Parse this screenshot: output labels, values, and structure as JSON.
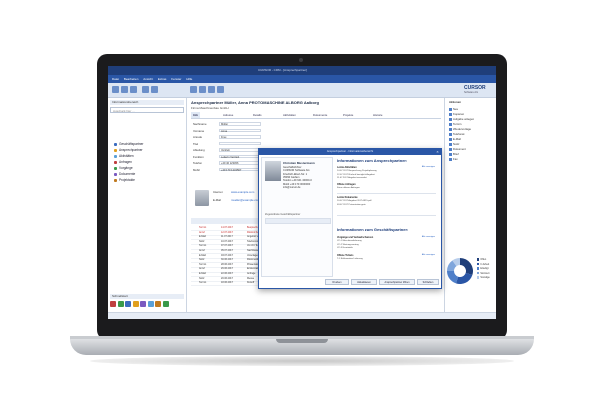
{
  "app": {
    "window_title": "CURSOR - CRM - [Ansprechpartner]",
    "menu": [
      "Datei",
      "Bearbeiten",
      "Ansicht",
      "Extras",
      "Fenster",
      "Hilfe"
    ],
    "brand": "CURSOR",
    "brand_sub": "Software AG"
  },
  "left": {
    "header": "Informationsbereich",
    "search_placeholder": "Ausdruck hier ...",
    "nav": [
      {
        "label": "Geschäftspartner",
        "color": "#3b6cc0"
      },
      {
        "label": "Ansprechpartner",
        "color": "#e0a020"
      },
      {
        "label": "Aktivitäten",
        "color": "#5aa0d8"
      },
      {
        "label": "Anfragen",
        "color": "#c04040"
      },
      {
        "label": "Vorgänge",
        "color": "#3a9a4a"
      },
      {
        "label": "Dokumente",
        "color": "#7a5ac0"
      },
      {
        "label": "Projektakte",
        "color": "#c07a20"
      }
    ],
    "bottom_header": "Schnellstart",
    "bottom_colors": [
      "#c04040",
      "#3a9a4a",
      "#3b6cc0",
      "#e0a020",
      "#7a5ac0",
      "#5aa0d8",
      "#c07a20",
      "#3a9a4a"
    ]
  },
  "main": {
    "title": "Ansprechpartner  Müller, Anna  PROTOMASCHINE ALBORG  Aalborg",
    "subtitle": "Firma  Maschinenbau GmbH",
    "tabs": [
      "Info",
      "Adresse",
      "Details",
      "Aktivitäten",
      "Dokumente",
      "Projekte",
      "Historie"
    ],
    "fields": [
      {
        "label": "Nachname",
        "value": "Müller"
      },
      {
        "label": "Vorname",
        "value": "Anna"
      },
      {
        "label": "Anrede",
        "value": "Frau"
      },
      {
        "label": "Titel",
        "value": ""
      },
      {
        "label": "Abteilung",
        "value": "Vertrieb"
      },
      {
        "label": "Funktion",
        "value": "Leiterin Vertrieb"
      },
      {
        "label": "Telefon",
        "value": "+49 40 123456"
      },
      {
        "label": "Mobil",
        "value": "+49 170 1234567"
      }
    ],
    "contact": {
      "email_label": "E-Mail",
      "email": "mueller@example.com",
      "web_label": "Internet",
      "web": "www.example.com"
    },
    "grid_rows": [
      {
        "c1": "Termin",
        "c2": "14.07.2017",
        "c3": "Besprechung Projekt",
        "red": true
      },
      {
        "c1": "Anruf",
        "c2": "12.07.2017",
        "c3": "Rückruf Angebot",
        "red": true
      },
      {
        "c1": "E-Mail",
        "c2": "11.07.2017",
        "c3": "Angebot versendet",
        "red": false
      },
      {
        "c1": "Notiz",
        "c2": "10.07.2017",
        "c3": "Telefonnotiz",
        "red": false
      },
      {
        "c1": "Termin",
        "c2": "07.07.2017",
        "c3": "Vor-Ort Termin",
        "red": false
      },
      {
        "c1": "Anruf",
        "c2": "05.07.2017",
        "c3": "Nachfassen",
        "red": false
      },
      {
        "c1": "E-Mail",
        "c2": "03.07.2017",
        "c3": "Unterlagen",
        "red": false
      },
      {
        "c1": "Notiz",
        "c2": "30.06.2017",
        "c3": "Rückmeldung",
        "red": false
      },
      {
        "c1": "Termin",
        "c2": "28.06.2017",
        "c3": "Präsentation",
        "red": false
      },
      {
        "c1": "Anruf",
        "c2": "26.06.2017",
        "c3": "Erstkontakt",
        "red": false
      },
      {
        "c1": "E-Mail",
        "c2": "22.06.2017",
        "c3": "Anfrage",
        "red": false
      },
      {
        "c1": "Notiz",
        "c2": "20.06.2017",
        "c3": "Messe",
        "red": false
      },
      {
        "c1": "Termin",
        "c2": "18.06.2017",
        "c3": "Kickoff",
        "red": false
      }
    ]
  },
  "right": {
    "header": "Aktionen",
    "items": [
      "Neu",
      "Kopieren",
      "Aufgabe anlegen",
      "Termin",
      "Wiedervorlage",
      "Telefonat",
      "E-Mail",
      "Notiz",
      "Dokument",
      "Brief",
      "Fax"
    ],
    "chart_legend": [
      {
        "label": "Offen",
        "color": "#1f3e7a"
      },
      {
        "label": "In Arbeit",
        "color": "#2a56a6"
      },
      {
        "label": "Erledigt",
        "color": "#4f7fc9"
      },
      {
        "label": "Storniert",
        "color": "#7fa6dc"
      },
      {
        "label": "Sonstige",
        "color": "#b7cdeb"
      }
    ],
    "chart_values": [
      0.3,
      0.25,
      0.2,
      0.15,
      0.1
    ]
  },
  "dialog": {
    "title": "Ansprechpartner - Informationsübersicht",
    "person_name": "Christian Mustermann",
    "person_lines": [
      "Geschäftsführer",
      "CURSOR Software AG",
      "Friedrich-Ebert-Str. 1",
      "35390 Gießen",
      "Telefon +49 641 40000-0",
      "Mobil +49 170 0000000",
      "info@cursor.de"
    ],
    "left_table_label": "Zugeordnete Geschäftspartner",
    "heading1": "Informationen zum Ansprechpartner:",
    "section1": "Letzte Aktivitäten",
    "section1_lines": [
      "14.07.2017  Besprechung Projektplanung",
      "12.07.2017  Rückruf bezüglich Angebot",
      "11.07.2017  Angebot versendet"
    ],
    "section2": "Offene Anfragen",
    "section2_lines": [
      "Keine offenen Anfragen"
    ],
    "section3": "Letzte Dokumente",
    "section3_lines": [
      "10.07.2017  Angebot 2017-0815.pdf",
      "03.07.2017  Präsentation.pptx"
    ],
    "heading2": "Informationen zum Geschäftspartner:",
    "section4": "Vorgänge und Verkaufschancen",
    "section4_lines": [
      "VC-1  Maschinenlieferung",
      "VC-2  Wartungsvertrag",
      "VC-3  Ersatzteile"
    ],
    "section5": "Offene Tickets",
    "section5_lines": [
      "T-1  Reklamation Lieferung"
    ],
    "link": "Alle anzeigen",
    "buttons": [
      "Drucken",
      "Aktualisieren",
      "Ansprechpartner öffnen",
      "Schließen"
    ]
  }
}
